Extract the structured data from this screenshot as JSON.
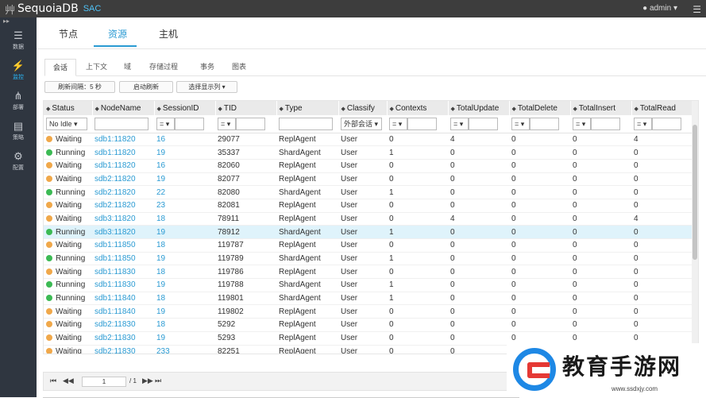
{
  "app": {
    "name": "SequoiaDB",
    "sub": "SAC",
    "tree_glyph": "⾋"
  },
  "header": {
    "user": "admin"
  },
  "sidebar": {
    "items": [
      {
        "label": "数据",
        "icon": "database-icon",
        "glyph": "☰"
      },
      {
        "label": "监控",
        "icon": "monitor-bolt-icon",
        "glyph": "⚡",
        "active": true
      },
      {
        "label": "部署",
        "icon": "share-icon",
        "glyph": "⋔"
      },
      {
        "label": "策略",
        "icon": "policy-icon",
        "glyph": "▤"
      },
      {
        "label": "配置",
        "icon": "gear-icon",
        "glyph": "⚙"
      }
    ]
  },
  "top_tabs": [
    {
      "label": "节点"
    },
    {
      "label": "资源",
      "active": true
    },
    {
      "label": "主机"
    }
  ],
  "sub_tabs": [
    {
      "label": "会话",
      "active": true
    },
    {
      "label": "上下文"
    },
    {
      "label": "域"
    },
    {
      "label": "存储过程"
    },
    {
      "label": "事务"
    },
    {
      "label": "图表"
    }
  ],
  "toolbar": {
    "refresh_interval": "刷新间隔：5 秒",
    "refresh_now": "启动刷新",
    "choose_columns": "选择显示列 ▾"
  },
  "table": {
    "columns": [
      "Status",
      "NodeName",
      "SessionID",
      "TID",
      "Type",
      "Classify",
      "Contexts",
      "TotalUpdate",
      "TotalDelete",
      "TotalInsert",
      "TotalRead"
    ],
    "filters": {
      "status": "No Idle ▾",
      "classify": "外部会话 ▾",
      "op": "= ▾"
    },
    "rows": [
      [
        "Waiting",
        "sdb1:11820",
        "16",
        "29077",
        "ReplAgent",
        "User",
        "0",
        "4",
        "0",
        "0",
        "4"
      ],
      [
        "Running",
        "sdb1:11820",
        "19",
        "35337",
        "ShardAgent",
        "User",
        "1",
        "0",
        "0",
        "0",
        "0"
      ],
      [
        "Waiting",
        "sdb1:11820",
        "16",
        "82060",
        "ReplAgent",
        "User",
        "0",
        "0",
        "0",
        "0",
        "0"
      ],
      [
        "Waiting",
        "sdb2:11820",
        "19",
        "82077",
        "ReplAgent",
        "User",
        "0",
        "0",
        "0",
        "0",
        "0"
      ],
      [
        "Running",
        "sdb2:11820",
        "22",
        "82080",
        "ShardAgent",
        "User",
        "1",
        "0",
        "0",
        "0",
        "0"
      ],
      [
        "Waiting",
        "sdb2:11820",
        "23",
        "82081",
        "ReplAgent",
        "User",
        "0",
        "0",
        "0",
        "0",
        "0"
      ],
      [
        "Waiting",
        "sdb3:11820",
        "18",
        "78911",
        "ReplAgent",
        "User",
        "0",
        "4",
        "0",
        "0",
        "4"
      ],
      [
        "Running",
        "sdb3:11820",
        "19",
        "78912",
        "ShardAgent",
        "User",
        "1",
        "0",
        "0",
        "0",
        "0"
      ],
      [
        "Waiting",
        "sdb1:11850",
        "18",
        "119787",
        "ReplAgent",
        "User",
        "0",
        "0",
        "0",
        "0",
        "0"
      ],
      [
        "Running",
        "sdb1:11850",
        "19",
        "119789",
        "ShardAgent",
        "User",
        "1",
        "0",
        "0",
        "0",
        "0"
      ],
      [
        "Waiting",
        "sdb1:11830",
        "18",
        "119786",
        "ReplAgent",
        "User",
        "0",
        "0",
        "0",
        "0",
        "0"
      ],
      [
        "Running",
        "sdb1:11830",
        "19",
        "119788",
        "ShardAgent",
        "User",
        "1",
        "0",
        "0",
        "0",
        "0"
      ],
      [
        "Running",
        "sdb1:11840",
        "18",
        "119801",
        "ShardAgent",
        "User",
        "1",
        "0",
        "0",
        "0",
        "0"
      ],
      [
        "Waiting",
        "sdb1:11840",
        "19",
        "119802",
        "ReplAgent",
        "User",
        "0",
        "0",
        "0",
        "0",
        "0"
      ],
      [
        "Waiting",
        "sdb2:11830",
        "18",
        "5292",
        "ReplAgent",
        "User",
        "0",
        "0",
        "0",
        "0",
        "0"
      ],
      [
        "Waiting",
        "sdb2:11830",
        "19",
        "5293",
        "ReplAgent",
        "User",
        "0",
        "0",
        "0",
        "0",
        "0"
      ],
      [
        "Waiting",
        "sdb2:11830",
        "233",
        "82251",
        "ReplAgent",
        "User",
        "0",
        "0",
        "",
        "",
        ""
      ]
    ],
    "highlight_row": 7,
    "status_colors": {
      "Waiting": "#f0a84a",
      "Running": "#3cba54"
    }
  },
  "pager": {
    "page": "1",
    "total": "/ 1"
  },
  "watermark": {
    "text": "教育手游网",
    "url": "www.ssdxjy.com"
  },
  "colors": {
    "accent": "#2b9bd3",
    "topbar": "#3d3d3d",
    "sidebar": "#2f3640"
  }
}
